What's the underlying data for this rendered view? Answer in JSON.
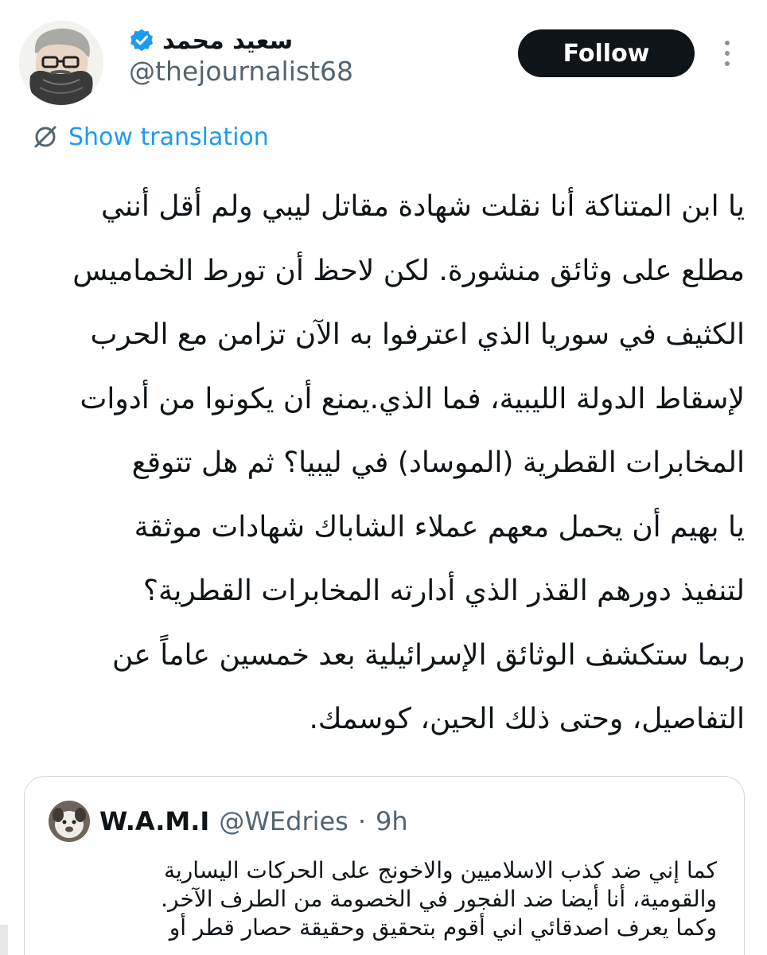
{
  "author": {
    "display_name": "سعيد محمد",
    "handle": "@thejournalist68",
    "avatar_icon": "avatar-portrait-icon",
    "verified_icon": "verified-badge-icon",
    "verified_color": "#1d9bf0"
  },
  "actions": {
    "follow_label": "Follow",
    "more_icon": "more-vertical-icon"
  },
  "translation": {
    "icon": "translate-icon",
    "label": "Show translation"
  },
  "tweet": {
    "lines": [
      "يا ابن المتناكة أنا نقلت شهادة مقاتل ليبي ولم أقل أنني",
      "مطلع على وثائق منشورة. لكن لاحظ أن تورط الخماميس",
      "الكثيف في سوريا الذي اعترفوا به الآن تزامن مع الحرب",
      "لإسقاط الدولة الليبية، فما الذي.يمنع أن يكونوا من أدوات",
      "المخابرات القطرية (الموساد) في ليبيا؟ ثم هل تتوقع",
      "يا بهيم أن يحمل معهم عملاء الشاباك شهادات موثقة",
      "لتنفيذ دورهم القذر الذي أدارته المخابرات القطرية؟",
      "ربما ستكشف الوثائق الإسرائيلية بعد خمسين عاماً عن",
      "التفاصيل، وحتى ذلك الحين، كوسمك."
    ]
  },
  "quote": {
    "name": "W.A.M.I",
    "handle": "@WEdries",
    "separator": "·",
    "time": "9h",
    "avatar_icon": "dog-avatar-icon",
    "lines": [
      "كما إني ضد كذب الاسلاميين والاخونج على الحركات اليسارية",
      "والقومية، أنا أيضا ضد الفجور في الخصومة من الطرف الآخر.",
      "وكما يعرف اصدقائي اني أقوم بتحقيق وحقيقة حصار قطر أو"
    ]
  },
  "colors": {
    "text": "#0f1419",
    "secondary": "#536471",
    "link": "#1d9bf0",
    "button_bg": "#0f1419",
    "border": "#cfd9de"
  }
}
